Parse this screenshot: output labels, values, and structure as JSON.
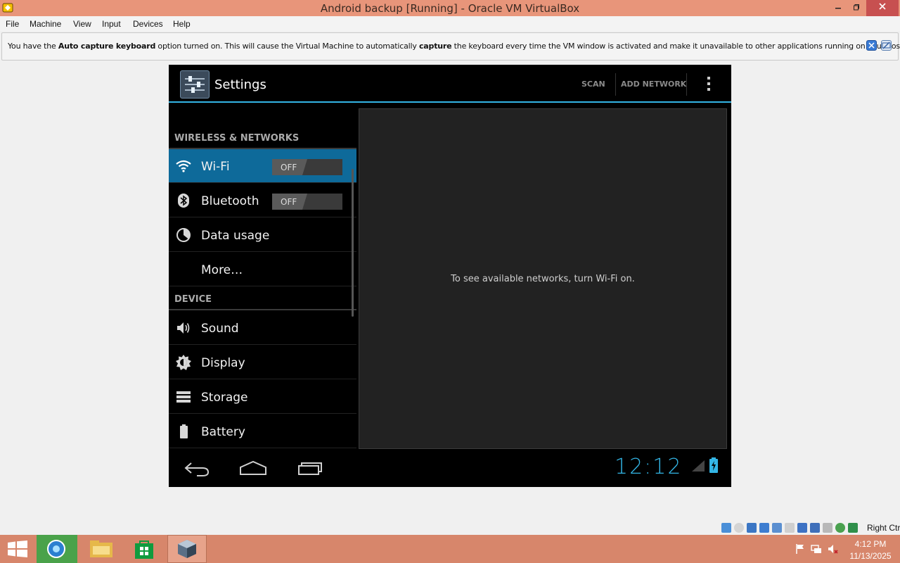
{
  "window": {
    "title": "Android backup [Running] - Oracle VM VirtualBox",
    "icon": "virtualbox-icon",
    "controls": [
      "minimize",
      "restore",
      "close"
    ]
  },
  "menubar": {
    "items": [
      "File",
      "Machine",
      "View",
      "Input",
      "Devices",
      "Help"
    ]
  },
  "notice": {
    "part1": "You have the ",
    "bold1": "Auto capture keyboard",
    "part2": " option turned on. This will cause the Virtual Machine to automatically ",
    "bold2": "capture",
    "part3": " the keyboard every time the VM window is activated and make it unavailable to other applications running on your host machine:"
  },
  "android": {
    "actionbar": {
      "title": "Settings",
      "scan": "SCAN",
      "add_network": "ADD NETWORK",
      "accent": "#33b5e5"
    },
    "sections": {
      "wireless": "WIRELESS & NETWORKS",
      "device": "DEVICE"
    },
    "items": {
      "wifi": {
        "label": "Wi-Fi",
        "toggle": "OFF",
        "icon": "wifi-icon"
      },
      "bluetooth": {
        "label": "Bluetooth",
        "toggle": "OFF",
        "icon": "bluetooth-icon"
      },
      "data_usage": {
        "label": "Data usage",
        "icon": "data-usage-icon"
      },
      "more": {
        "label": "More…"
      },
      "sound": {
        "label": "Sound",
        "icon": "speaker-icon"
      },
      "display": {
        "label": "Display",
        "icon": "brightness-icon"
      },
      "storage": {
        "label": "Storage",
        "icon": "storage-icon"
      },
      "battery": {
        "label": "Battery",
        "icon": "battery-icon"
      }
    },
    "detail": {
      "empty_message": "To see available networks, turn Wi-Fi on."
    },
    "navbar": {
      "clock": "12:12"
    }
  },
  "vbox_status": {
    "host_key": "Right Ctrl"
  },
  "taskbar": {
    "time": "4:12 PM",
    "date": "11/13/2025",
    "color": "#d7866b"
  }
}
